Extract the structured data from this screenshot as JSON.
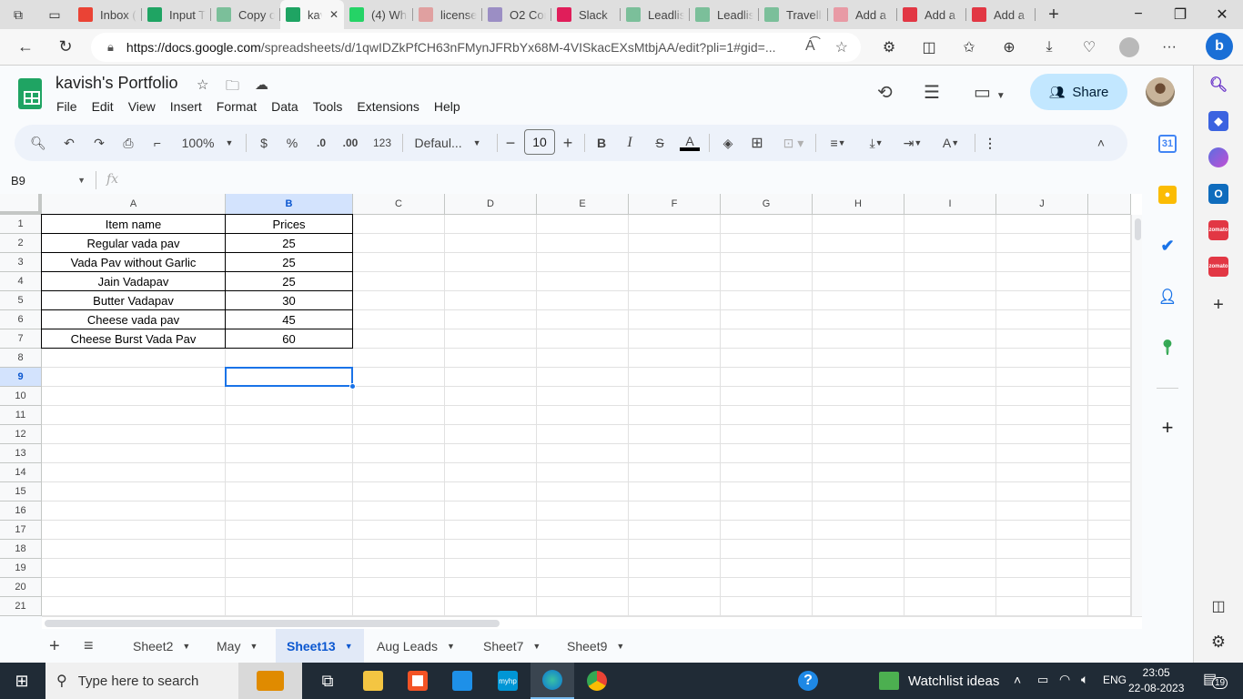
{
  "browser": {
    "tabs": [
      {
        "label": "Inbox (",
        "icon": "gmail-icon",
        "color": "#ea4335"
      },
      {
        "label": "Input T",
        "icon": "sheets-icon",
        "color": "#1fa463"
      },
      {
        "label": "Copy o",
        "icon": "sheets-icon",
        "color": "#7bbf9a"
      },
      {
        "label": "kav",
        "icon": "sheets-icon",
        "color": "#1fa463",
        "active": true
      },
      {
        "label": "(4) Wha",
        "icon": "whatsapp-icon",
        "color": "#25d366"
      },
      {
        "label": "license",
        "icon": "pdf-icon",
        "color": "#e0a0a0"
      },
      {
        "label": "O2 Cor",
        "icon": "forms-icon",
        "color": "#9b8ec4"
      },
      {
        "label": "Slack",
        "icon": "slack-icon",
        "color": "#e01e5a"
      },
      {
        "label": "Leadlis",
        "icon": "sheets-icon",
        "color": "#7bbf9a"
      },
      {
        "label": "Leadlis",
        "icon": "sheets-icon",
        "color": "#7bbf9a"
      },
      {
        "label": "Travelli",
        "icon": "sheets-icon",
        "color": "#7bbf9a"
      },
      {
        "label": "Add a",
        "icon": "zomato-icon",
        "color": "#e89aa5"
      },
      {
        "label": "Add a",
        "icon": "zomato-icon",
        "color": "#e23744"
      },
      {
        "label": "Add a",
        "icon": "zomato-icon",
        "color": "#e23744"
      }
    ],
    "url_host": "https://docs.google.com",
    "url_path": "/spreadsheets/d/1qwIDZkPfCH63nFMynJFRbYx68M-4VISkacEXsMtbjAA/edit?pli=1#gid=..."
  },
  "doc": {
    "title": "kavish's Portfolio",
    "menu": [
      "File",
      "Edit",
      "View",
      "Insert",
      "Format",
      "Data",
      "Tools",
      "Extensions",
      "Help"
    ],
    "share_label": "Share"
  },
  "toolbar": {
    "zoom": "100%",
    "currency": "$",
    "percent": "%",
    "dec_decrease": ".0",
    "dec_increase": ".00",
    "number_format": "123",
    "font": "Defaul...",
    "font_size": "10"
  },
  "formula_bar": {
    "cell_ref": "B9",
    "fx": "fx",
    "value": ""
  },
  "sheet": {
    "columns": [
      "A",
      "B",
      "C",
      "D",
      "E",
      "F",
      "G",
      "H",
      "I",
      "J"
    ],
    "rows": [
      "1",
      "2",
      "3",
      "4",
      "5",
      "6",
      "7",
      "8",
      "9",
      "10",
      "11",
      "12",
      "13",
      "14",
      "15",
      "16",
      "17",
      "18",
      "19",
      "20",
      "21"
    ],
    "selected_cell": "B9",
    "headers": [
      "Item name",
      "Prices"
    ],
    "data": [
      [
        "Regular vada pav",
        "25"
      ],
      [
        "Vada Pav without Garlic",
        "25"
      ],
      [
        "Jain Vadapav",
        "25"
      ],
      [
        "Butter Vadapav",
        "30"
      ],
      [
        "Cheese vada pav",
        "45"
      ],
      [
        "Cheese Burst Vada Pav",
        "60"
      ]
    ]
  },
  "sheet_tabs": [
    {
      "label": "Sheet2"
    },
    {
      "label": "May"
    },
    {
      "label": "Sheet13",
      "active": true
    },
    {
      "label": "Aug Leads"
    },
    {
      "label": "Sheet7"
    },
    {
      "label": "Sheet9"
    }
  ],
  "taskbar": {
    "search_placeholder": "Type here to search",
    "widget_label": "Watchlist ideas",
    "lang": "ENG",
    "time": "23:05",
    "date": "22-08-2023",
    "notifications": "19"
  },
  "colors": {
    "accent": "#0b57d0",
    "selection": "#1a73e8",
    "share_bg": "#c2e7ff",
    "sheets_green": "#1fa463"
  }
}
